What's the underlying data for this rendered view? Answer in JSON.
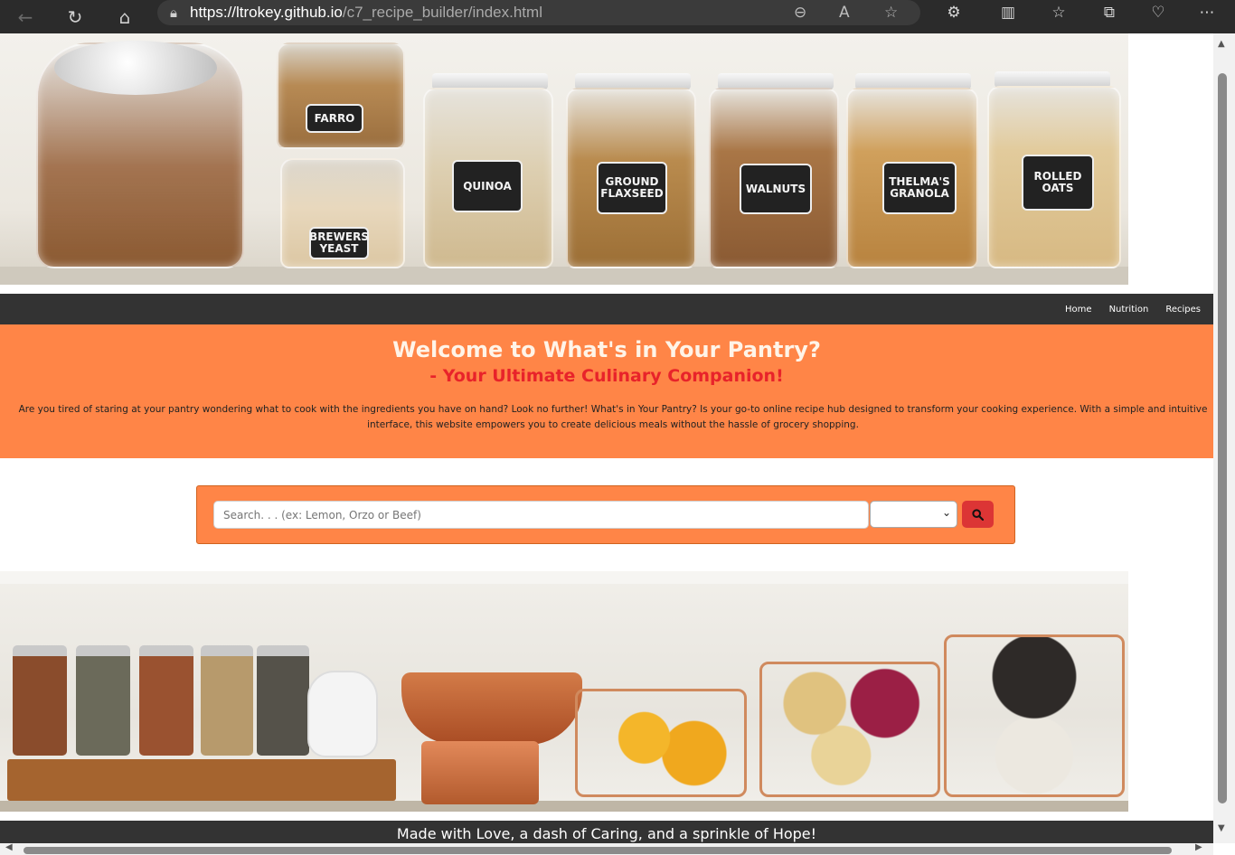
{
  "browser": {
    "url_host": "https://ltrokey.github.io",
    "url_path": "/c7_recipe_builder/index.html",
    "icons": [
      "back-icon",
      "refresh-icon",
      "home-icon",
      "lock-icon",
      "zoom-out-icon",
      "read-aloud-icon",
      "favorite-icon",
      "extensions-icon",
      "split-screen-icon",
      "favorites-icon",
      "collections-icon",
      "performance-icon",
      "more-icon"
    ]
  },
  "hero": {
    "labels": [
      "FARRO",
      "BREWERS YEAST",
      "QUINOA",
      "GROUND FLAXSEED",
      "WALNUTS",
      "THELMA'S GRANOLA",
      "ROLLED OATS"
    ]
  },
  "nav": {
    "home": "Home",
    "nutrition": "Nutrition",
    "recipes": "Recipes"
  },
  "welcome": {
    "title": "Welcome to What's in Your Pantry?",
    "subtitle": "- Your Ultimate Culinary Companion!",
    "body": "Are you tired of staring at your pantry wondering what to cook with the ingredients you have on hand? Look no further! What's in Your Pantry? Is your go-to online recipe hub designed to transform your cooking experience. With a simple and intuitive interface, this website empowers you to create delicious meals without the hassle of grocery shopping."
  },
  "search": {
    "placeholder": "Search. . . (ex: Lemon, Orzo or Beef)",
    "select_value": "",
    "button_icon": "search-icon"
  },
  "footer": {
    "text": "Made with Love, a dash of Caring, and a sprinkle of Hope!"
  },
  "colors": {
    "accent_orange": "#ff8547",
    "dark_bar": "#333333",
    "subtitle_red": "#e8232a",
    "search_button_red": "#dc3535"
  }
}
